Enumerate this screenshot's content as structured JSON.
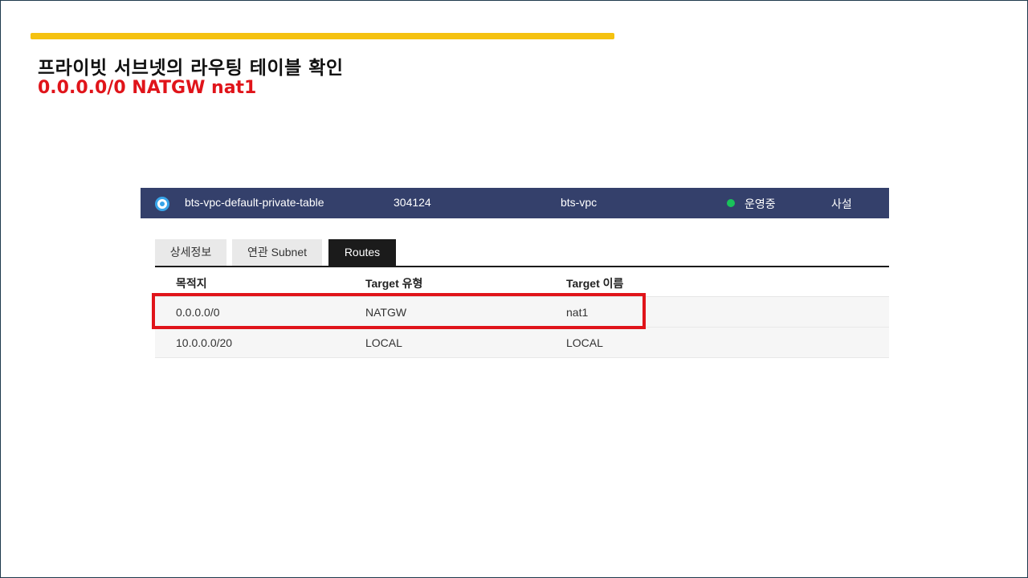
{
  "slide": {
    "title": "프라이빗 서브넷의 라우팅 테이블 확인",
    "subtitle": "0.0.0.0/0 NATGW nat1",
    "accent_color": "#f5c210",
    "subtitle_color": "#e0141a"
  },
  "route_table": {
    "name": "bts-vpc-default-private-table",
    "id": "304124",
    "vpc": "bts-vpc",
    "status": "운영중",
    "type": "사설",
    "header_color": "#34406b"
  },
  "tabs": [
    {
      "label": "상세정보",
      "active": false
    },
    {
      "label": "연관 Subnet",
      "active": false
    },
    {
      "label": "Routes",
      "active": true
    }
  ],
  "routes": {
    "columns": [
      "목적지",
      "Target 유형",
      "Target 이름"
    ],
    "rows": [
      {
        "destination": "0.0.0.0/0",
        "target_type": "NATGW",
        "target_name": "nat1"
      },
      {
        "destination": "10.0.0.0/20",
        "target_type": "LOCAL",
        "target_name": "LOCAL"
      }
    ]
  }
}
